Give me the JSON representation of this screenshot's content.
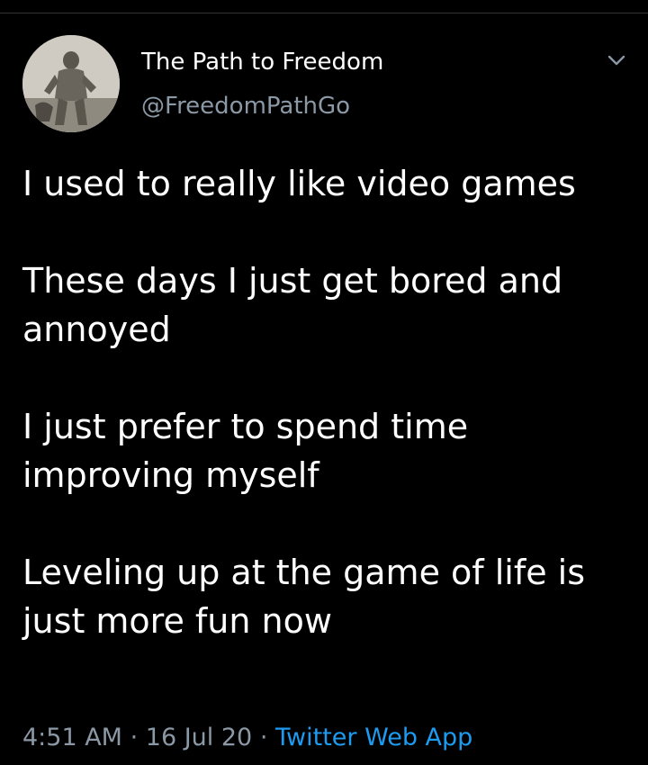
{
  "author": {
    "name": "The Path to Freedom",
    "handle": "@FreedomPathGo",
    "avatar_icon": "statue-avatar"
  },
  "menu_icon": "chevron-down-icon",
  "tweet": {
    "paragraphs": [
      "I used to really like video games",
      "These days I just get bored and annoyed",
      "I just prefer to spend time improving myself",
      "Leveling up at the game of life is just more fun now"
    ]
  },
  "meta": {
    "time": "4:51 AM",
    "separator": "·",
    "date": "16 Jul 20",
    "source": "Twitter Web App"
  },
  "colors": {
    "background": "#000000",
    "text": "#ffffff",
    "secondary": "#8b98a5",
    "link": "#1d9bf0"
  }
}
